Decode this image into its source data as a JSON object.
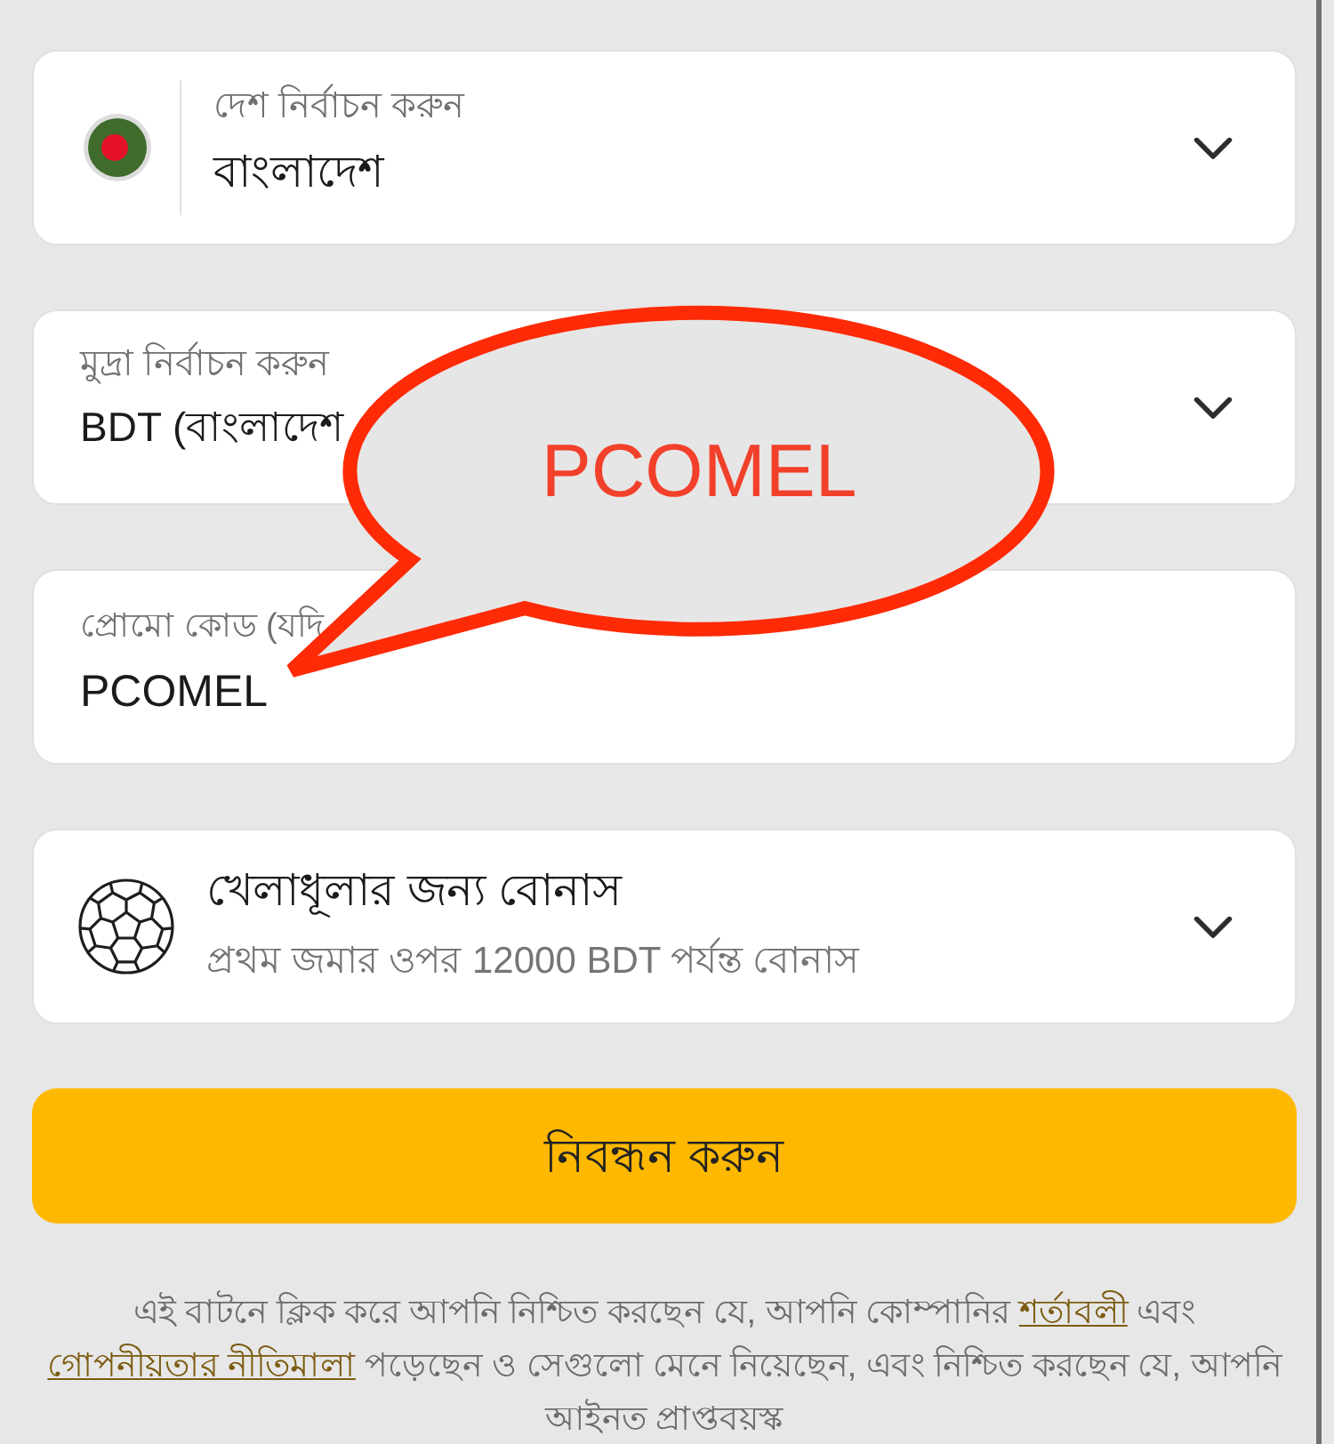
{
  "fields": [
    {
      "kind": "country",
      "label": "দেশ নির্বাচন করুন",
      "value": "বাংলাদেশ"
    },
    {
      "kind": "currency",
      "label": "মুদ্রা নির্বাচন করুন",
      "value": "BDT (বাংলাদেশ"
    },
    {
      "kind": "promo",
      "label": "প্রোমো কোড (যদি",
      "value": "PCOMEL"
    },
    {
      "kind": "bonus",
      "title": "খেলাধূলার জন্য বোনাস",
      "subtitle": "প্রথম জমার ওপর 12000 BDT পর্যন্ত বোনাস"
    }
  ],
  "register_button": {
    "label": "নিবন্ধন করুন"
  },
  "legal_notice": [
    {
      "kind": "text",
      "text": "এই বাটনে ক্লিক করে আপনি নিশ্চিত করছেন যে, আপনি কোম্পানির "
    },
    {
      "kind": "link",
      "text": "শর্তাবলী"
    },
    {
      "kind": "text",
      "text": " এবং "
    },
    {
      "kind": "link",
      "text": "গোপনীয়তার নীতিমালা"
    },
    {
      "kind": "text",
      "text": " পড়েছেন ও সেগুলো মেনে নিয়েছেন, এবং নিশ্চিত করছেন যে, আপনি আইনত প্রাপ্তবয়স্ক"
    }
  ],
  "callout": {
    "text": "PCOMEL"
  }
}
